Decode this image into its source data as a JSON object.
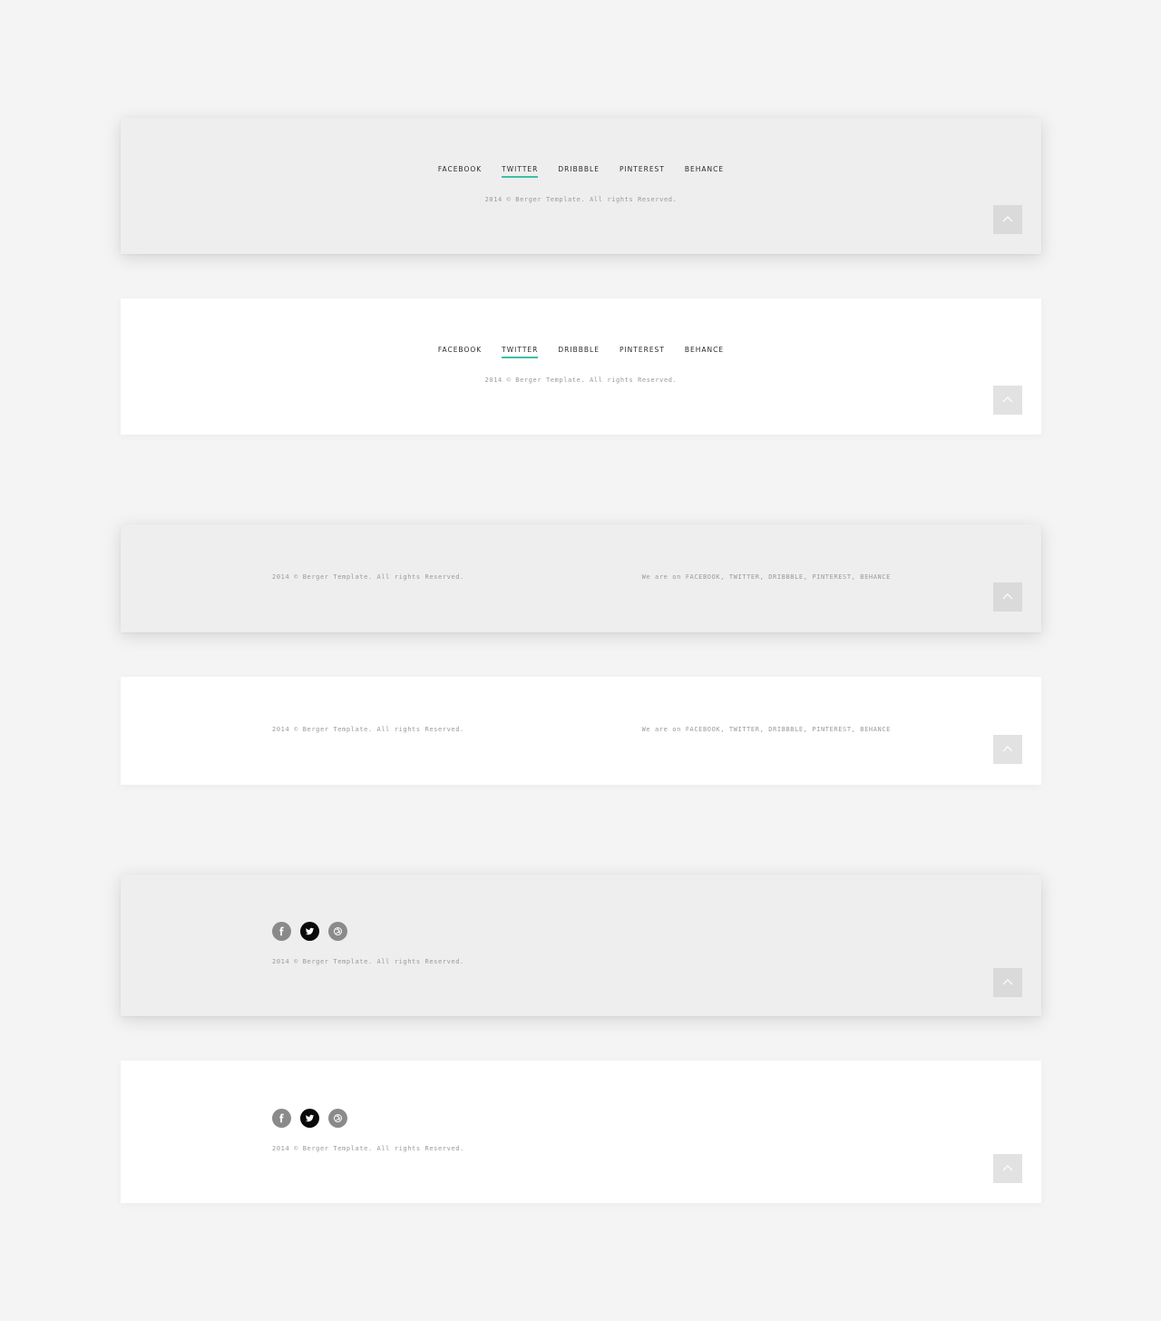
{
  "nav_links": [
    "FACEBOOK",
    "TWITTER",
    "DRIBBBLE",
    "PINTEREST",
    "BEHANCE"
  ],
  "active_nav": "TWITTER",
  "copyright": "2014 © Berger Template. All rights Reserved.",
  "social_text": "We are on FACEBOOK, TWITTER, DRIBBBLE, PINTEREST, BEHANCE",
  "social_icons": [
    "facebook-icon",
    "twitter-icon",
    "dribbble-icon"
  ],
  "back_to_top_icon": "chevron-up-icon",
  "colors": {
    "page_background": "#f4f4f4",
    "grey_panel": "#eeeeee",
    "white_panel": "#ffffff",
    "active_underline": "#3dbfa5",
    "nav_text": "#2a2a2a",
    "muted_text": "#9a9a9a",
    "back_to_top_button": "#dadada",
    "social_icon_grey": "#8a8a8a",
    "social_icon_active": "#0a0a0a"
  }
}
